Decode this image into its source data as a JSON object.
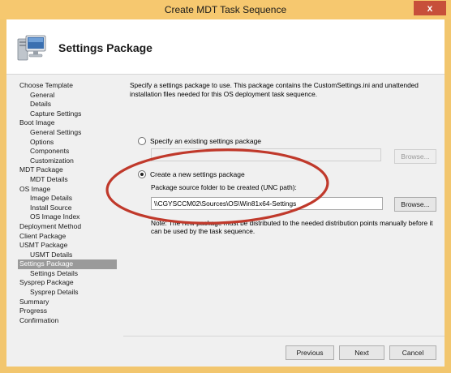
{
  "window": {
    "title": "Create MDT Task Sequence",
    "close_label": "x"
  },
  "header": {
    "title": "Settings Package",
    "icon": "computer-icon"
  },
  "nav": [
    {
      "label": "Choose Template",
      "level": 1
    },
    {
      "label": "General",
      "level": 2
    },
    {
      "label": "Details",
      "level": 2
    },
    {
      "label": "Capture Settings",
      "level": 2
    },
    {
      "label": "Boot Image",
      "level": 1
    },
    {
      "label": "General Settings",
      "level": 2
    },
    {
      "label": "Options",
      "level": 2
    },
    {
      "label": "Components",
      "level": 2
    },
    {
      "label": "Customization",
      "level": 2
    },
    {
      "label": "MDT Package",
      "level": 1
    },
    {
      "label": "MDT Details",
      "level": 2
    },
    {
      "label": "OS Image",
      "level": 1
    },
    {
      "label": "Image Details",
      "level": 2
    },
    {
      "label": "Install Source",
      "level": 2
    },
    {
      "label": "OS Image Index",
      "level": 2
    },
    {
      "label": "Deployment Method",
      "level": 1
    },
    {
      "label": "Client Package",
      "level": 1
    },
    {
      "label": "USMT Package",
      "level": 1
    },
    {
      "label": "USMT Details",
      "level": 2
    },
    {
      "label": "Settings Package",
      "level": 1,
      "selected": true
    },
    {
      "label": "Settings Details",
      "level": 2
    },
    {
      "label": "Sysprep Package",
      "level": 1
    },
    {
      "label": "Sysprep Details",
      "level": 2
    },
    {
      "label": "Summary",
      "level": 1
    },
    {
      "label": "Progress",
      "level": 1
    },
    {
      "label": "Confirmation",
      "level": 1
    }
  ],
  "content": {
    "description": "Specify a settings package to use.  This package contains the CustomSettings.ini and unattended installation files needed for this OS deployment task sequence.",
    "existing_option": "Specify an existing settings package",
    "existing_value": "",
    "browse_label": "Browse...",
    "new_option": "Create a new settings package",
    "source_label": "Package source folder to be created (UNC path):",
    "source_value": "\\\\CGYSCCM02\\Sources\\OS\\Win81x64-Settings",
    "note": "Note:  The new package must be distributed to the needed distribution points manually before it can be used by the task sequence."
  },
  "footer": {
    "previous": "Previous",
    "next": "Next",
    "cancel": "Cancel"
  },
  "colors": {
    "title_bar": "#f6c86f",
    "close": "#c74f3a",
    "highlight_ellipse": "#c0392b",
    "nav_selected": "#9a9a9a"
  }
}
